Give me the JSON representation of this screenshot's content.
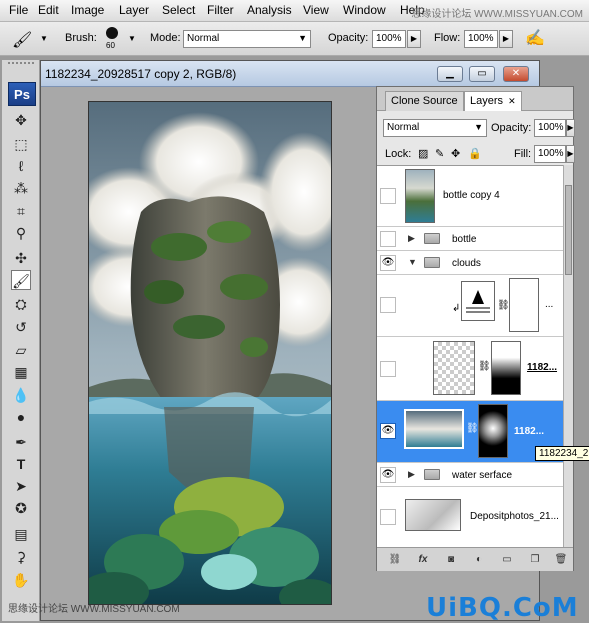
{
  "menubar": {
    "items": [
      "File",
      "Edit",
      "Image",
      "Layer",
      "Select",
      "Filter",
      "Analysis",
      "View",
      "Window",
      "Help"
    ],
    "watermark": "思缘设计论坛 WWW.MISSYUAN.COM"
  },
  "options": {
    "brush_label": "Brush:",
    "brush_size": "60",
    "mode_label": "Mode:",
    "mode_value": "Normal",
    "opacity_label": "Opacity:",
    "opacity_value": "100%",
    "flow_label": "Flow:",
    "flow_value": "100%"
  },
  "toolbox": {
    "logo": "Ps",
    "tools": [
      "move-icon",
      "marquee-icon",
      "lasso-icon",
      "quick-select-icon",
      "crop-icon",
      "eyedropper-icon",
      "healing-icon",
      "brush-icon",
      "clone-stamp-icon",
      "history-brush-icon",
      "eraser-icon",
      "gradient-icon",
      "blur-icon",
      "dodge-icon",
      "pen-icon",
      "type-icon",
      "path-select-icon",
      "shape-icon",
      "notes-icon",
      "eyedropper2-icon",
      "hand-icon"
    ]
  },
  "document": {
    "title": "1182234_20928517 copy 2, RGB/8)"
  },
  "panel": {
    "tabs": [
      "Clone Source",
      "Layers"
    ],
    "blend_mode": "Normal",
    "opacity_label": "Opacity:",
    "opacity_value": "100%",
    "lock_label": "Lock:",
    "fill_label": "Fill:",
    "fill_value": "100%",
    "layers": [
      {
        "name": "bottle copy 4",
        "visible": false,
        "type": "layer"
      },
      {
        "name": "bottle",
        "visible": false,
        "type": "group"
      },
      {
        "name": "clouds",
        "visible": true,
        "type": "group"
      },
      {
        "name": "...",
        "visible": false,
        "type": "adjustment"
      },
      {
        "name": "1182...",
        "visible": false,
        "type": "layer"
      },
      {
        "name": "1182...",
        "visible": true,
        "type": "layer",
        "selected": true
      },
      {
        "name": "water serface",
        "visible": true,
        "type": "group"
      },
      {
        "name": "Depositphotos_21...",
        "visible": false,
        "type": "layer"
      }
    ],
    "tooltip": "1182234_2"
  },
  "watermarks": {
    "bottom_left": "思缘设计论坛 WWW.MISSYUAN.COM",
    "bottom_right": "UiBQ.CoM"
  },
  "colors": {
    "selection": "#3a8cf0",
    "ps_logo": "#2c5fb8"
  }
}
